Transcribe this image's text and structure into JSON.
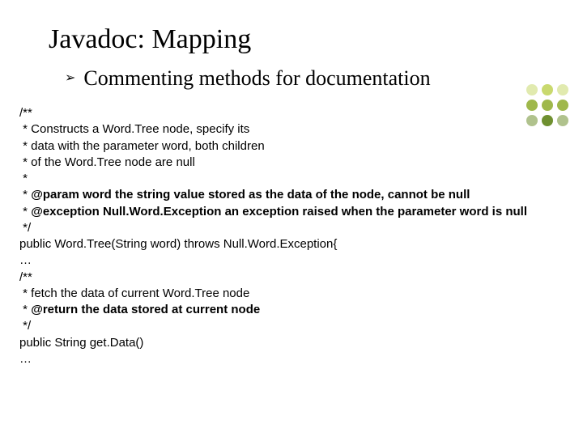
{
  "slide": {
    "title": "Javadoc: Mapping",
    "bullet_glyph": "➢",
    "subtitle": "Commenting methods for documentation",
    "code": {
      "l01": "/**",
      "l02": " * Constructs a Word.Tree node, specify its",
      "l03": " * data with the parameter word, both children",
      "l04": " * of the Word.Tree node are null",
      "l05": " *",
      "l06a": " * ",
      "l06b": "@param",
      "l06c": " word the string value stored as the data of the node, cannot be null",
      "l07a": " * ",
      "l07b": "@exception",
      "l07c": " Null.Word.Exception an exception raised when the parameter word is null",
      "l08": " */",
      "l09": "public Word.Tree(String word) throws Null.Word.Exception{",
      "l10": "…",
      "l11": "/**",
      "l12": " * fetch the data of current Word.Tree node",
      "l13a": " * ",
      "l13b": "@return",
      "l13c": " the data stored at current node",
      "l14": " */",
      "l15": "public String get.Data()",
      "l16": "…"
    }
  }
}
